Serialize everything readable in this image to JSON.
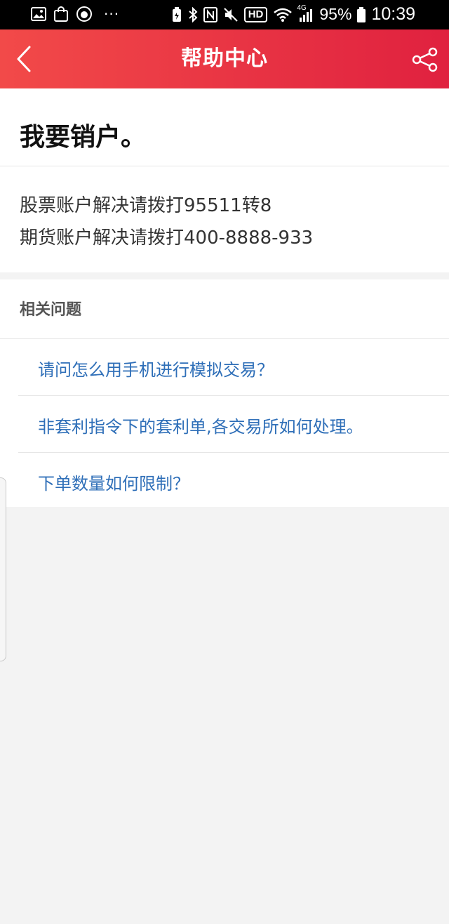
{
  "status_bar": {
    "battery_percent": "95%",
    "time": "10:39",
    "hd_label": "HD",
    "network_label": "4G",
    "more_dots": "···"
  },
  "header": {
    "title": "帮助中心"
  },
  "question": {
    "title": "我要销户。",
    "answers": [
      "股票账户解决请拨打95511转8",
      "期货账户解决请拨打400-8888-933"
    ]
  },
  "related": {
    "header": "相关问题",
    "items": [
      "请问怎么用手机进行模拟交易？",
      "非套利指令下的套利单,各交易所如何处理。",
      "下单数量如何限制？"
    ]
  },
  "colors": {
    "header_start": "#f24a49",
    "header_end": "#e0213f",
    "link": "#2f6fb8",
    "background": "#f3f3f3"
  }
}
